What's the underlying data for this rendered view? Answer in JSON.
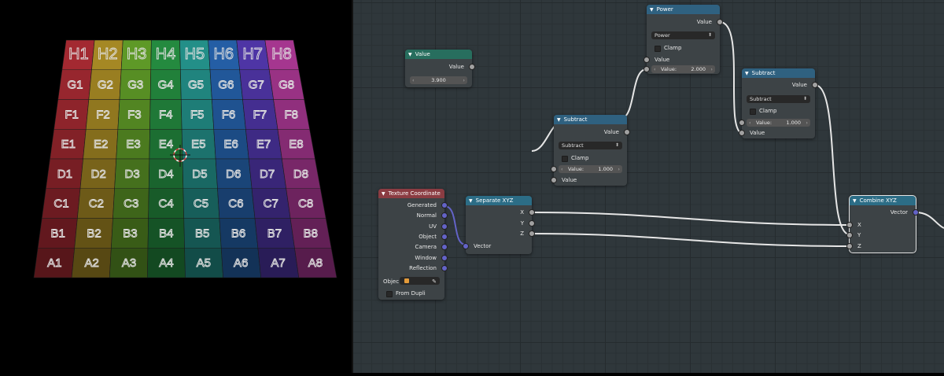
{
  "viewport": {
    "grid_rows": [
      "H",
      "G",
      "F",
      "E",
      "D",
      "C",
      "B",
      "A"
    ],
    "grid_cols": [
      "1",
      "2",
      "3",
      "4",
      "5",
      "6",
      "7",
      "8"
    ],
    "column_colors": [
      "#c0303a",
      "#c2a02a",
      "#6fb42e",
      "#2aa24a",
      "#29a8a0",
      "#2a6fc2",
      "#5c3ec2",
      "#c23fa8"
    ]
  },
  "nodes": {
    "value": {
      "title": "Value",
      "output": "Value",
      "value": "3.900"
    },
    "power": {
      "title": "Power",
      "output": "Value",
      "operation": "Power",
      "clamp": "Clamp",
      "input1": "Value",
      "input2_label": "Value:",
      "input2_value": "2.000"
    },
    "subtract1": {
      "title": "Subtract",
      "output": "Value",
      "operation": "Subtract",
      "clamp": "Clamp",
      "input1_label": "Value:",
      "input1_value": "1.000",
      "input2": "Value"
    },
    "subtract2": {
      "title": "Subtract",
      "output": "Value",
      "operation": "Subtract",
      "clamp": "Clamp",
      "input1_label": "Value:",
      "input1_value": "1.000",
      "input2": "Value"
    },
    "texcoord": {
      "title": "Texture Coordinate",
      "outputs": [
        "Generated",
        "Normal",
        "UV",
        "Object",
        "Camera",
        "Window",
        "Reflection"
      ],
      "object_label": "Objec",
      "from_dupli": "From Dupli"
    },
    "separate": {
      "title": "Separate XYZ",
      "outputs": [
        "X",
        "Y",
        "Z"
      ],
      "input": "Vector"
    },
    "combine": {
      "title": "Combine XYZ",
      "output": "Vector",
      "inputs": [
        "X",
        "Y",
        "Z"
      ]
    }
  },
  "colors": {
    "value_header": "#276e5e",
    "math_header": "#2f6180",
    "input_header": "#8b3c42",
    "converter_header": "#2c6d86",
    "vector_socket": "#6363c7",
    "float_socket": "#a1a1a1"
  }
}
